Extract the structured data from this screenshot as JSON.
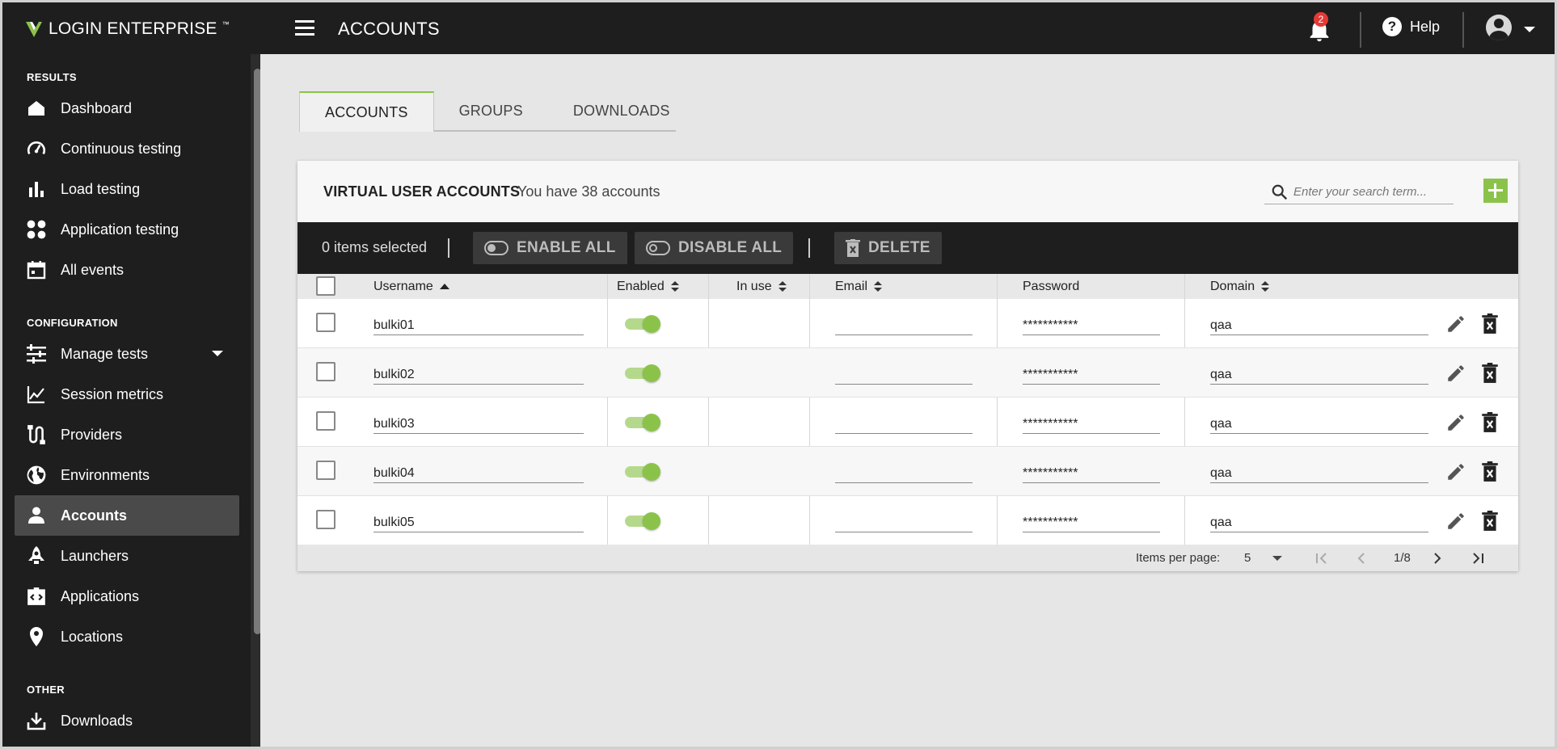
{
  "brand": {
    "name": "LOGIN ENTERPRISE",
    "trademark": "™",
    "accent": "#8bc34a"
  },
  "header": {
    "title": "ACCOUNTS",
    "notification_count": "2",
    "help_label": "Help"
  },
  "sidebar": {
    "sections": [
      {
        "label": "RESULTS"
      },
      {
        "label": "CONFIGURATION"
      },
      {
        "label": "OTHER"
      }
    ],
    "items": [
      {
        "label": "Dashboard",
        "icon": "home-icon"
      },
      {
        "label": "Continuous testing",
        "icon": "gauge-icon"
      },
      {
        "label": "Load testing",
        "icon": "bar-chart-icon"
      },
      {
        "label": "Application testing",
        "icon": "apps-icon"
      },
      {
        "label": "All events",
        "icon": "calendar-icon"
      },
      {
        "label": "Manage tests",
        "icon": "sliders-icon"
      },
      {
        "label": "Session metrics",
        "icon": "line-chart-icon"
      },
      {
        "label": "Providers",
        "icon": "connector-icon"
      },
      {
        "label": "Environments",
        "icon": "globe-icon"
      },
      {
        "label": "Accounts",
        "icon": "person-icon",
        "active": true
      },
      {
        "label": "Launchers",
        "icon": "rocket-icon"
      },
      {
        "label": "Applications",
        "icon": "code-window-icon"
      },
      {
        "label": "Locations",
        "icon": "pin-icon"
      },
      {
        "label": "Downloads",
        "icon": "download-icon"
      }
    ]
  },
  "tabs": [
    {
      "label": "ACCOUNTS",
      "active": true
    },
    {
      "label": "GROUPS"
    },
    {
      "label": "DOWNLOADS"
    }
  ],
  "card": {
    "title": "VIRTUAL USER ACCOUNTS",
    "subtitle": "You have 38 accounts",
    "search_placeholder": "Enter your search term..."
  },
  "toolbar": {
    "selected_text": "0 items selected",
    "enable_all": "ENABLE ALL",
    "disable_all": "DISABLE ALL",
    "delete": "DELETE"
  },
  "table": {
    "columns": [
      "Username",
      "Enabled",
      "In use",
      "Email",
      "Password",
      "Domain"
    ],
    "rows": [
      {
        "username": "bulki01",
        "enabled": true,
        "in_use": "",
        "email": "",
        "password": "***********",
        "domain": "qaa"
      },
      {
        "username": "bulki02",
        "enabled": true,
        "in_use": "",
        "email": "",
        "password": "***********",
        "domain": "qaa"
      },
      {
        "username": "bulki03",
        "enabled": true,
        "in_use": "",
        "email": "",
        "password": "***********",
        "domain": "qaa"
      },
      {
        "username": "bulki04",
        "enabled": true,
        "in_use": "",
        "email": "",
        "password": "***********",
        "domain": "qaa"
      },
      {
        "username": "bulki05",
        "enabled": true,
        "in_use": "",
        "email": "",
        "password": "***********",
        "domain": "qaa"
      }
    ]
  },
  "pagination": {
    "items_per_page_label": "Items per page:",
    "items_per_page": "5",
    "page_info": "1/8"
  }
}
